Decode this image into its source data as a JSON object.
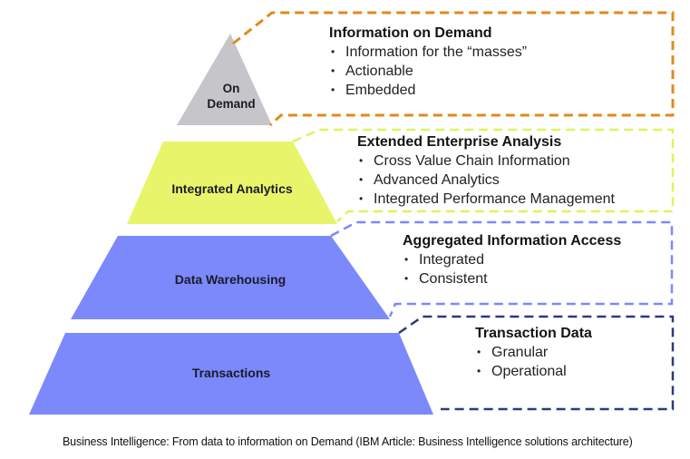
{
  "levels": [
    {
      "name": "On Demand",
      "label_lines": [
        "On",
        "Demand"
      ],
      "fill_color": "#c6c5c9",
      "border_color": "#e08a1e",
      "panel": {
        "heading": "Information on Demand",
        "bullets": [
          "Information for the “masses”",
          "Actionable",
          "Embedded"
        ]
      }
    },
    {
      "name": "Integrated Analytics",
      "label_lines": [
        "Integrated Analytics"
      ],
      "fill_color": "#e8f56b",
      "border_color": "#e2f25c",
      "panel": {
        "heading": "Extended Enterprise Analysis",
        "bullets": [
          "Cross Value Chain Information",
          "Advanced Analytics",
          "Integrated Performance Management"
        ]
      }
    },
    {
      "name": "Data Warehousing",
      "label_lines": [
        "Data Warehousing"
      ],
      "fill_color": "#7b89fb",
      "border_color": "#7b89fb",
      "panel": {
        "heading": "Aggregated Information Access",
        "bullets": [
          "Integrated",
          "Consistent"
        ]
      }
    },
    {
      "name": "Transactions",
      "label_lines": [
        "Transactions"
      ],
      "fill_color": "#7b89fb",
      "border_color": "#2f3a7a",
      "panel": {
        "heading": "Transaction Data",
        "bullets": [
          "Granular",
          "Operational"
        ]
      }
    }
  ],
  "bullet_glyph": "•",
  "caption": "Business Intelligence: From data to information on Demand (IBM Article: Business Intelligence solutions architecture)"
}
